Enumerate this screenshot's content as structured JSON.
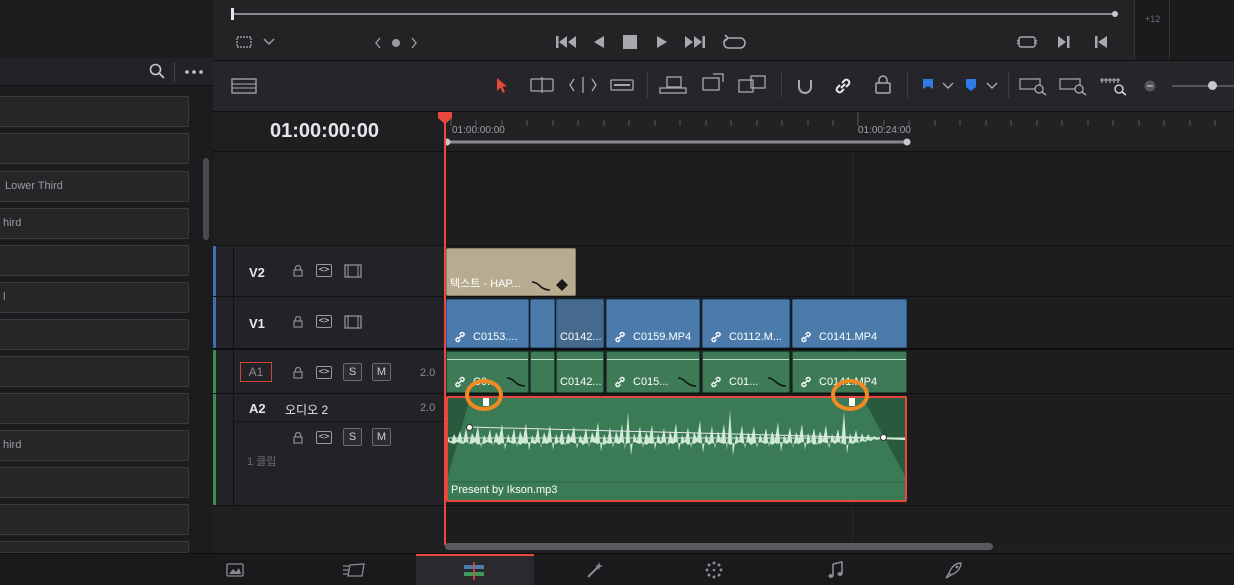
{
  "colors": {
    "accent": "#e8493c",
    "video_clip": "#4a7bab",
    "audio_clip": "#3d7a55",
    "text_clip": "#b8ac90",
    "marker_blue": "#2f7be6",
    "highlight_ring": "#f08a22"
  },
  "viewer": {
    "timecode_right": "+12"
  },
  "left_panel": {
    "items": [
      "",
      "",
      "",
      "Lower Third",
      "hird",
      "",
      "l",
      "",
      "",
      "",
      "",
      "hird",
      "",
      "",
      ""
    ]
  },
  "timeline": {
    "timecode": "01:00:00:00",
    "ruler_labels": [
      "01:00:00:00",
      "01:00:24:00"
    ],
    "tracks": {
      "v2": {
        "name": "V2"
      },
      "v1": {
        "name": "V1"
      },
      "a1": {
        "name": "A1",
        "level": "2.0",
        "solo": "S",
        "mute": "M"
      },
      "a2": {
        "name": "A2",
        "label": "오디오 2",
        "level": "2.0",
        "solo": "S",
        "mute": "M",
        "clip_count": "1 클립"
      }
    },
    "v2_clips": [
      {
        "label": "텍스트 - HAP..."
      }
    ],
    "v1_clips": [
      {
        "label": "C0153...."
      },
      {
        "label": ""
      },
      {
        "label": "C0142..."
      },
      {
        "label": "C0159.MP4"
      },
      {
        "label": "C0112.M..."
      },
      {
        "label": "C0141.MP4"
      }
    ],
    "a1_clips": [
      {
        "label": "C0..."
      },
      {
        "label": ""
      },
      {
        "label": "C0142..."
      },
      {
        "label": "C015..."
      },
      {
        "label": "C01..."
      },
      {
        "label": "C0141.MP4"
      }
    ],
    "a2_clip": {
      "label": "Present by Ikson.mp3"
    }
  },
  "icons": {
    "toolbar": [
      "timeline-view-icon",
      "selection-arrow-icon",
      "trim-edit-icon",
      "dynamic-trim-icon",
      "blade-icon",
      "insert-clip-icon",
      "overwrite-clip-icon",
      "replace-clip-icon",
      "snapping-icon",
      "linked-selection-icon",
      "position-lock-icon",
      "flag-icon",
      "marker-icon",
      "zoom-full-icon",
      "zoom-detail-icon",
      "zoom-custom-icon"
    ],
    "transport": [
      "go-to-start-icon",
      "reverse-play-icon",
      "stop-icon",
      "play-icon",
      "go-to-end-icon",
      "loop-icon"
    ],
    "pages": [
      "media-page-icon",
      "cut-page-icon",
      "edit-page-icon",
      "fusion-page-icon",
      "color-page-icon",
      "fairlight-page-icon",
      "deliver-page-icon"
    ]
  }
}
